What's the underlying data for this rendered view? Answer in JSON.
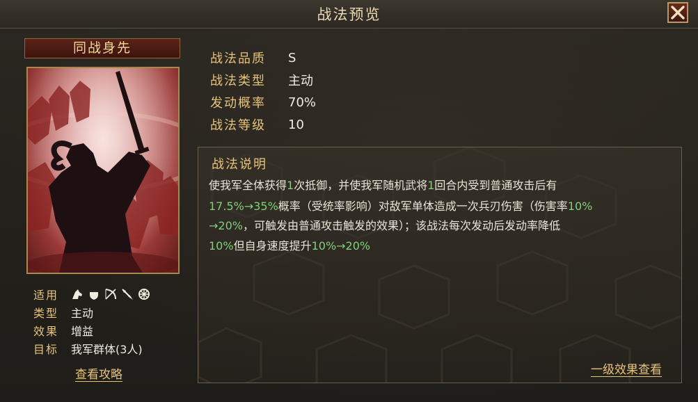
{
  "title": "战法预览",
  "skill": {
    "name": "同战身先",
    "stats": [
      {
        "label": "战法品质",
        "value": "S"
      },
      {
        "label": "战法类型",
        "value": "主动"
      },
      {
        "label": "发动概率",
        "value": "70%"
      },
      {
        "label": "战法等级",
        "value": "10"
      }
    ]
  },
  "info": {
    "applicable_label": "适用",
    "applicable_icons": [
      "cavalry-icon",
      "shield-icon",
      "bow-icon",
      "spear-icon",
      "wheel-icon"
    ],
    "type_label": "类型",
    "type_value": "主动",
    "effect_label": "效果",
    "effect_value": "增益",
    "target_label": "目标",
    "target_value": "我军群体(3人)"
  },
  "guide_link": "查看攻略",
  "description": {
    "title": "战法说明",
    "lines": [
      [
        {
          "t": "使我军全体获得"
        },
        {
          "t": "1",
          "g": true
        },
        {
          "t": "次抵御，并使我军随机武将"
        },
        {
          "t": "1",
          "g": true
        },
        {
          "t": "回合内受到普通攻击后有"
        }
      ],
      [
        {
          "t": "17.5%→35%",
          "g": true
        },
        {
          "t": "概率（受统率影响）对敌军单体造成一次兵刃伤害（伤害率"
        },
        {
          "t": "10%",
          "g": true
        }
      ],
      [
        {
          "t": "→20%",
          "g": true
        },
        {
          "t": "，可触发由普通攻击触发的效果）；该战法每次发动后发动率降低"
        }
      ],
      [
        {
          "t": "10%",
          "g": true
        },
        {
          "t": "但自身速度提升"
        },
        {
          "t": "10%→20%",
          "g": true
        }
      ]
    ]
  },
  "effects_link": "一级效果查看",
  "colors": {
    "gold": "#e5c47a",
    "green": "#7fd07a",
    "text": "#e9e4d8"
  }
}
